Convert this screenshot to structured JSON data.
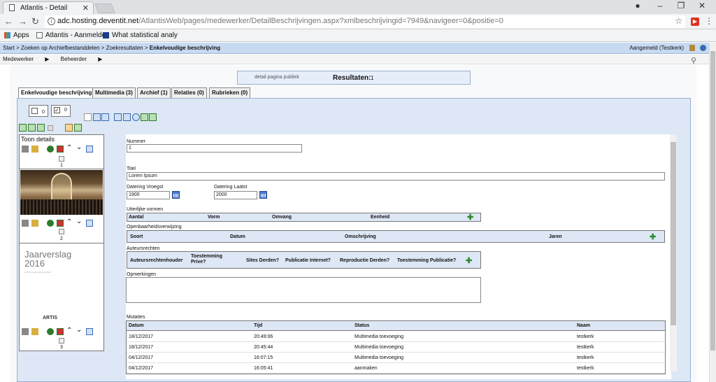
{
  "browser": {
    "tab_title": "Atlantis - Detail",
    "url_host": "adc.hosting.deventit.net",
    "url_path": "/AtlantisWeb/pages/medewerker/DetailBeschrijvingen.aspx?xmlbeschrijvingid=7949&navigeer=0&positie=0",
    "bookmarks": [
      {
        "label": "Apps",
        "icon": "apps-grid-icon"
      },
      {
        "label": "Atlantis - Aanmelden",
        "icon": "page-icon"
      },
      {
        "label": "What statistical analy",
        "icon": "site-icon"
      }
    ]
  },
  "app": {
    "breadcrumb": [
      "Start",
      "Zoeken op Archiefbestanddelen",
      "Zoekresultaten"
    ],
    "breadcrumb_current": "Enkelvoudige beschrijving",
    "logged_in": "Aangemeld (Testkerk)",
    "menu": [
      "Medewerker",
      "Beheerder"
    ],
    "results_publiek": "detail pagina publiek",
    "results_label": "Resultaten:",
    "results_count": "1",
    "tabs": [
      {
        "label": "Enkelvoudige beschrijving",
        "active": true
      },
      {
        "label": "Multimedia (3)",
        "active": false
      },
      {
        "label": "Archief (1)",
        "active": false
      },
      {
        "label": "Relaties (0)",
        "active": false
      },
      {
        "label": "Rubrieken (0)",
        "active": false
      }
    ],
    "checkbox_counts": [
      "0",
      "0"
    ]
  },
  "thumbnails": [
    {
      "alt": "Toon details",
      "number": "1"
    },
    {
      "alt": "",
      "number": "2"
    },
    {
      "title": "Jaarverslag 2016",
      "subtitle": "ARTIS maakt iets geschiften",
      "brand": "ARTIS",
      "number": "3"
    }
  ],
  "form": {
    "nummer_label": "Nummer",
    "nummer_value": "1",
    "titel_label": "Titel",
    "titel_value": "Lorem Ipsum",
    "datering_vroegst_label": "Datering Vroegst",
    "datering_vroegst_value": "1900",
    "datering_laatst_label": "Datering Laatst",
    "datering_laatst_value": "2000",
    "uiterlijke_label": "Uiterlijke vormen",
    "uiterlijke_cols": [
      "Aantal",
      "Vorm",
      "Omvang",
      "Eenheid"
    ],
    "openbaarheid_label": "Openbaarheidsverwijzing",
    "openbaarheid_cols": [
      "Soort",
      "Datum",
      "Omschrijving",
      "Jaren"
    ],
    "auteurs_label": "Auteursrechten",
    "auteurs_cols": [
      "Auteursrechtenhouder",
      "Toestemming Prive?",
      "Sites Derden?",
      "Publicatie Internet?",
      "Reproductie Derden?",
      "Toestemming Publicatie?"
    ],
    "opmerkingen_label": "Opmerkingen",
    "mutaties_label": "Mutaties",
    "mutaties_cols": [
      "Datum",
      "Tijd",
      "Status",
      "Naam"
    ],
    "mutaties": [
      [
        "18/12/2017",
        "20:49:06",
        "Multimedia toevoeging",
        "testkerk"
      ],
      [
        "18/12/2017",
        "20:45:44",
        "Multimedia toevoeging",
        "testkerk"
      ],
      [
        "04/12/2017",
        "16:07:15",
        "Multimedia toevoeging",
        "testkerk"
      ],
      [
        "04/12/2017",
        "16:05:41",
        "aanmaken",
        "testkerk"
      ]
    ]
  },
  "colors": {
    "header": "#c8daf2",
    "panel": "#dde7f5",
    "add": "#2d8a2d"
  }
}
